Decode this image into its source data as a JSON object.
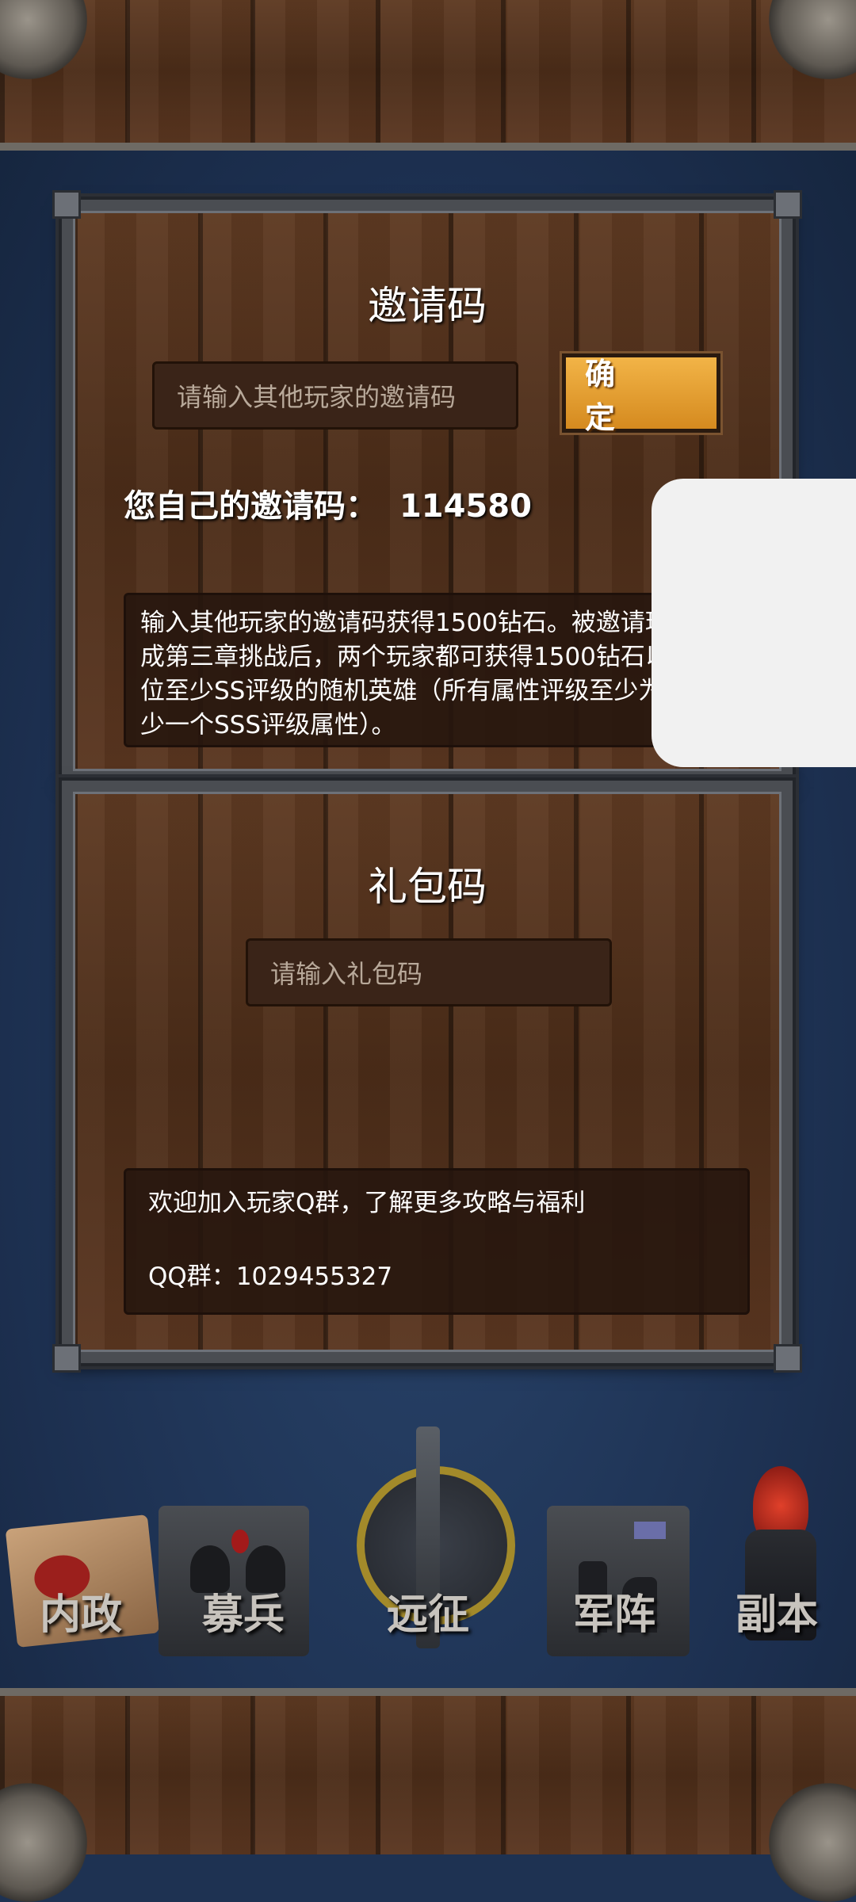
{
  "invite": {
    "title": "邀请码",
    "input_placeholder": "请输入其他玩家的邀请码",
    "confirm_label": "确 定",
    "own_code_label": "您自己的邀请码：",
    "own_code_value": "114580",
    "description": "输入其他玩家的邀请码获得1500钻石。被邀请玩家完成第三章挑战后，两个玩家都可获得1500钻石以及一位至少SS评级的随机英雄（所有属性评级至少为S，至少一个SSS评级属性）。"
  },
  "gift": {
    "title": "礼包码",
    "input_placeholder": "请输入礼包码",
    "welcome_text": "欢迎加入玩家Q群，了解更多攻略与福利",
    "qq_label": "QQ群：",
    "qq_number": "1029455327"
  },
  "nav": {
    "items": [
      {
        "label": "内政",
        "icon": "scroll-seal-icon"
      },
      {
        "label": "募兵",
        "icon": "soldiers-icon"
      },
      {
        "label": "远征",
        "icon": "sword-emblem-icon"
      },
      {
        "label": "军阵",
        "icon": "chess-formation-icon"
      },
      {
        "label": "副本",
        "icon": "dark-flame-icon"
      }
    ]
  },
  "colors": {
    "accent_button": "#e09a2c",
    "background_blue": "#1e3252",
    "wood_brown": "#4b2c18"
  }
}
